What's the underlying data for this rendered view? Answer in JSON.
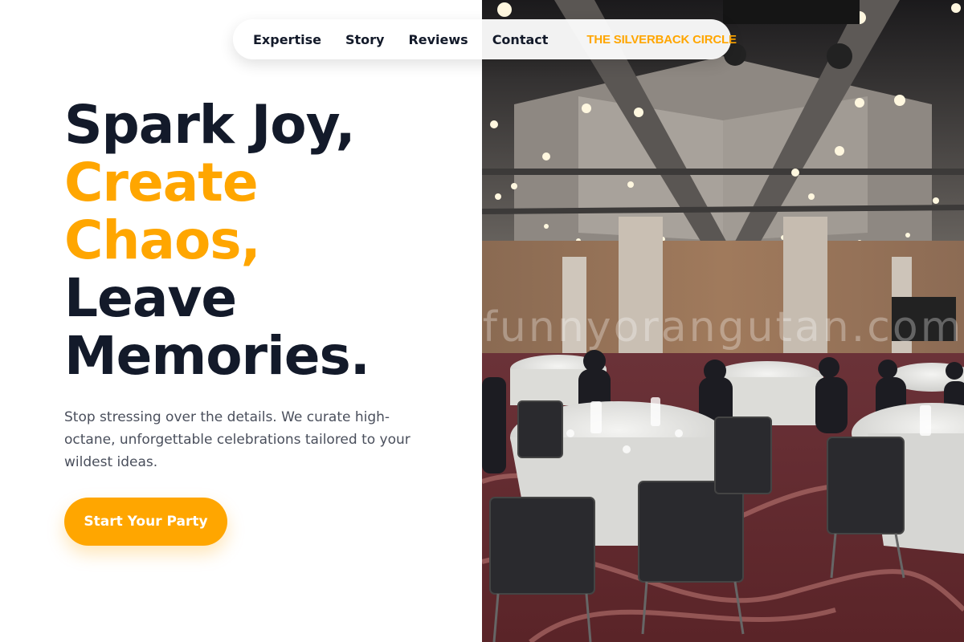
{
  "nav": {
    "links": [
      {
        "label": "Expertise"
      },
      {
        "label": "Story"
      },
      {
        "label": "Reviews"
      },
      {
        "label": "Contact"
      }
    ],
    "brand": "THE SILVERBACK CIRCLE"
  },
  "hero": {
    "headline": [
      "Spark Joy,",
      "Create",
      "Chaos,",
      "Leave",
      "Memories."
    ],
    "subtext": "Stop stressing over the details. We curate high-octane, unforgettable celebrations tailored to your wildest ideas.",
    "cta_label": "Start Your Party"
  },
  "photo": {
    "watermark": "funnyorangutan.com"
  },
  "colors": {
    "accent": "#ffa600",
    "heading": "#131a2a",
    "body_text": "#4a4f5c"
  }
}
